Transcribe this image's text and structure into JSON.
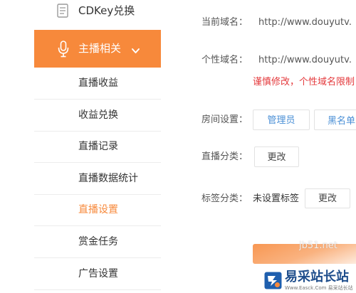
{
  "sidebar": {
    "cdkey": {
      "label": "CDKey兑换",
      "icon": "document-icon"
    },
    "group": {
      "label": "主播相关",
      "icon": "microphone-icon",
      "expanded": true
    },
    "items": [
      {
        "label": "直播收益",
        "active": false
      },
      {
        "label": "收益兑换",
        "active": false
      },
      {
        "label": "直播记录",
        "active": false
      },
      {
        "label": "直播数据统计",
        "active": false
      },
      {
        "label": "直播设置",
        "active": true
      },
      {
        "label": "赏金任务",
        "active": false
      },
      {
        "label": "广告设置",
        "active": false
      }
    ]
  },
  "content": {
    "current_domain": {
      "label": "当前域名：",
      "value": "http://www.douyutv."
    },
    "custom_domain": {
      "label": "个性域名：",
      "value": "http://www.douyutv."
    },
    "domain_warning": "谨慎修改，个性域名限制",
    "room_settings": {
      "label": "房间设置：",
      "admin_button": "管理员",
      "blacklist_button": "黑名单"
    },
    "category": {
      "label": "直播分类：",
      "change_button": "更改"
    },
    "tags": {
      "label": "标签分类：",
      "value": "未设置标签",
      "change_button": "更改"
    }
  },
  "watermark": {
    "site": "jb51.net",
    "brand": "易采站长站",
    "url": "Www.Easck.Com 易采站长站"
  },
  "colors": {
    "accent": "#f7893b",
    "warning": "#e4393c",
    "link": "#4a8fd6",
    "brand": "#1f4e8c"
  }
}
